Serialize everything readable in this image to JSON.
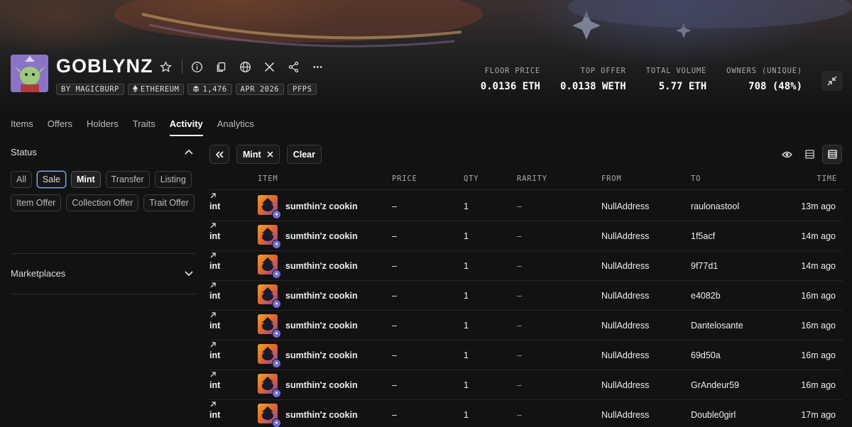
{
  "collection": {
    "name": "GOBLYNZ",
    "badges": {
      "creator": "BY MAGICBURP",
      "chain": "ETHEREUM",
      "supply": "1,476",
      "date": "APR 2026",
      "symbol": "PFPS"
    },
    "stats": [
      {
        "label": "FLOOR PRICE",
        "value": "0.0136 ETH"
      },
      {
        "label": "TOP OFFER",
        "value": "0.0138 WETH"
      },
      {
        "label": "TOTAL VOLUME",
        "value": "5.77 ETH"
      },
      {
        "label": "OWNERS (UNIQUE)",
        "value": "708 (48%)"
      }
    ]
  },
  "tabs": [
    "Items",
    "Offers",
    "Holders",
    "Traits",
    "Activity",
    "Analytics"
  ],
  "active_tab": "Activity",
  "sidebar": {
    "status_label": "Status",
    "chips": [
      "All",
      "Sale",
      "Mint",
      "Transfer",
      "Listing",
      "Item Offer",
      "Collection Offer",
      "Trait Offer"
    ],
    "marketplaces_label": "Marketplaces"
  },
  "filter": {
    "active_chip": "Mint",
    "clear_label": "Clear"
  },
  "table": {
    "headers": {
      "item": "ITEM",
      "price": "PRICE",
      "qty": "QTY",
      "rarity": "RARITY",
      "from": "FROM",
      "to": "TO",
      "time": "TIME"
    },
    "rows": [
      {
        "type": "int",
        "item": "sumthin'z cookin",
        "price": "–",
        "qty": "1",
        "rarity": "–",
        "from": "NullAddress",
        "to": "raulonastool",
        "time": "13m ago"
      },
      {
        "type": "int",
        "item": "sumthin'z cookin",
        "price": "–",
        "qty": "1",
        "rarity": "–",
        "from": "NullAddress",
        "to": "1f5acf",
        "time": "14m ago"
      },
      {
        "type": "int",
        "item": "sumthin'z cookin",
        "price": "–",
        "qty": "1",
        "rarity": "–",
        "from": "NullAddress",
        "to": "9f77d1",
        "time": "14m ago"
      },
      {
        "type": "int",
        "item": "sumthin'z cookin",
        "price": "–",
        "qty": "1",
        "rarity": "–",
        "from": "NullAddress",
        "to": "e4082b",
        "time": "16m ago"
      },
      {
        "type": "int",
        "item": "sumthin'z cookin",
        "price": "–",
        "qty": "1",
        "rarity": "–",
        "from": "NullAddress",
        "to": "Dantelosante",
        "time": "16m ago"
      },
      {
        "type": "int",
        "item": "sumthin'z cookin",
        "price": "–",
        "qty": "1",
        "rarity": "–",
        "from": "NullAddress",
        "to": "69d50a",
        "time": "16m ago"
      },
      {
        "type": "int",
        "item": "sumthin'z cookin",
        "price": "–",
        "qty": "1",
        "rarity": "–",
        "from": "NullAddress",
        "to": "GrAndeur59",
        "time": "16m ago"
      },
      {
        "type": "int",
        "item": "sumthin'z cookin",
        "price": "–",
        "qty": "1",
        "rarity": "–",
        "from": "NullAddress",
        "to": "Double0girl",
        "time": "17m ago"
      }
    ]
  }
}
